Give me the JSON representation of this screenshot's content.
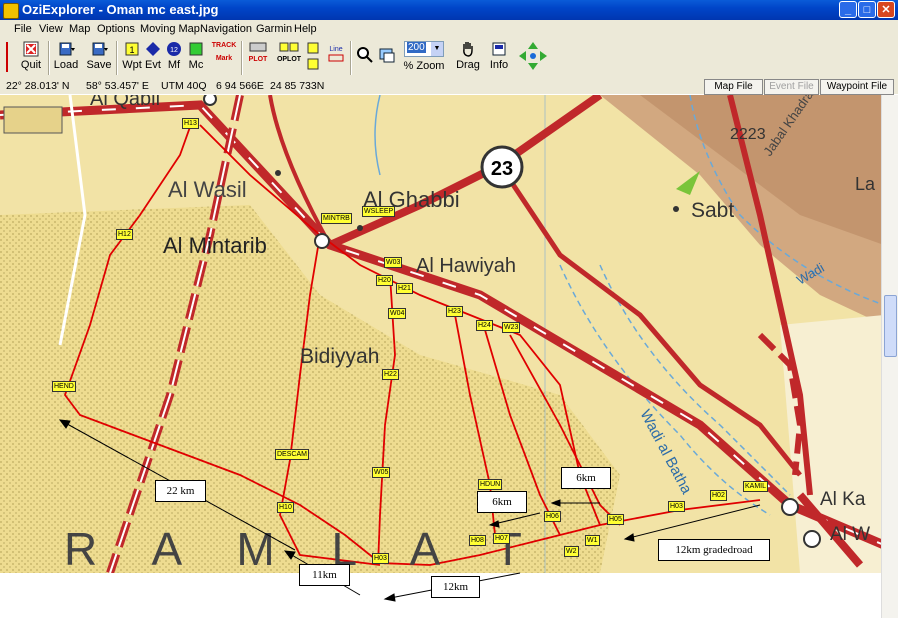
{
  "window": {
    "title": "OziExplorer - Oman mc east.jpg"
  },
  "menu": [
    "File",
    "View",
    "Map",
    "Options",
    "Moving Map",
    "Navigation",
    "Garmin",
    "Help"
  ],
  "toolbar": {
    "quit": "Quit",
    "load": "Load",
    "save": "Save",
    "wpt": "Wpt",
    "evt": "Evt",
    "mf": "Mf",
    "mc": "Mc",
    "track": "TRACK",
    "mark": "Mark",
    "plot": "PLOT",
    "oplot": "OPLOT",
    "line": "Line",
    "zoom_value": "200",
    "zoom_label": "% Zoom",
    "drag": "Drag",
    "info": "Info"
  },
  "status": {
    "lat": "22° 28.013' N",
    "lon": "58° 53.457' E",
    "utm": "UTM  40Q",
    "easting": "6 94 566E",
    "northing": "24 85 733N",
    "map_file": "Map File",
    "event_file": "Event File",
    "waypoint_file": "Waypoint File"
  },
  "map_labels": {
    "al_qabil": "Al Qabil",
    "al_wasil": "Al Wasil",
    "al_mintarib": "Al Mintarib",
    "al_ghabbi": "Al Ghabbi",
    "al_hawiyah": "Al Hawiyah",
    "bidiyyah": "Bidiyyah",
    "sabt": "Sabt",
    "route23": "23",
    "height_2223": "2223",
    "wadi_al_batha": "Wadi al Batha",
    "wadi_small": "Wadi",
    "ramlat": "R A M L A T",
    "al_ka": "Al Ka",
    "al_w": "Al W",
    "la": "La",
    "jabal": "Jabal Khadra"
  },
  "waypoints": [
    "H13",
    "H12",
    "MINTRB",
    "WSLEEP",
    "W03",
    "H20",
    "H21",
    "W04",
    "H23",
    "H24",
    "W23",
    "H22",
    "HEND",
    "DESCAM",
    "W05",
    "H10",
    "H03",
    "HDUN",
    "H06",
    "H08",
    "H07",
    "W2",
    "W1",
    "H05",
    "H03",
    "H02",
    "KAMIL"
  ],
  "annotations": {
    "a22": "22 km",
    "a11": "11km",
    "a12": "12km",
    "a6a": "6km",
    "a6b": "6km",
    "a12g": "12km gradedroad"
  },
  "colors": {
    "title_bar": "#0a5bd8",
    "map_bg": "#f2e3a6",
    "route": "#e00000",
    "waypoint": "#ffff33"
  }
}
